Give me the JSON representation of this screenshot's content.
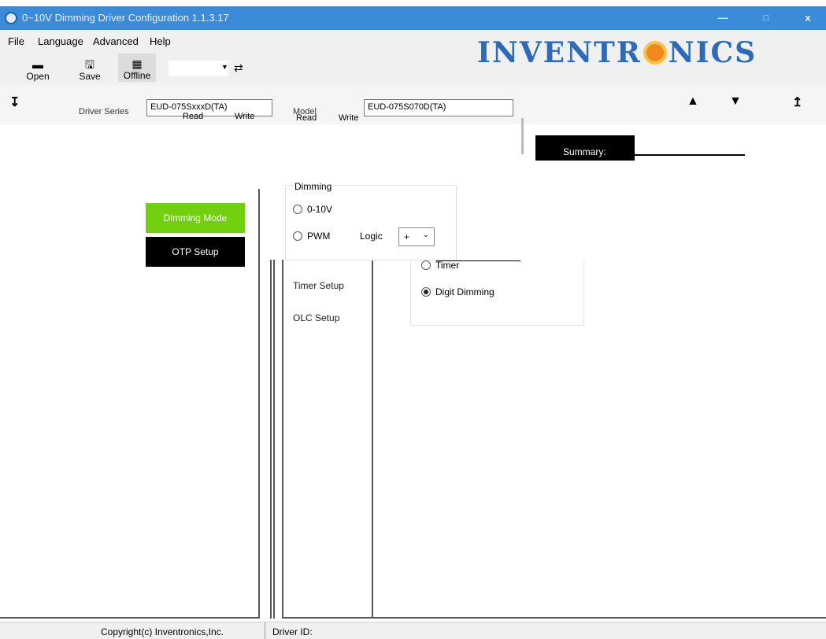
{
  "window": {
    "title": "0~10V Dimming Driver Configuration 1.1.3.17",
    "minimize_glyph": "—",
    "maximize_glyph": "□",
    "close_glyph": "x"
  },
  "menu": {
    "items": [
      {
        "label": "File"
      },
      {
        "label": "Language"
      },
      {
        "label": "Advanced"
      },
      {
        "label": "Help"
      }
    ]
  },
  "toolbar": {
    "open_label": "Open",
    "save_label": "Save",
    "offline_label": "Offline",
    "port_value": "",
    "icons": [
      "folder-icon",
      "floppy-disk-icon",
      "driver-icon",
      "usb-icon"
    ]
  },
  "logo": {
    "text_left": "INVENTR",
    "text_right": "NICS",
    "brand_color": "#2d6ab8"
  },
  "series": {
    "driver_series_label": "Driver Series",
    "driver_series_value": "EUD-075SxxxD(TA)",
    "model_label": "Model",
    "model_value": "EUD-075S070D(TA)",
    "read_label": "Read",
    "write_label": "Write"
  },
  "summary": {
    "tab_label": "Summary:"
  },
  "sidebar": {
    "dimming_mode_label": "Dimming Mode",
    "otp_setup_label": "OTP Setup",
    "active_color": "#72d00e"
  },
  "subnav": {
    "timer_setup_label": "Timer Setup",
    "olc_setup_label": "OLC Setup"
  },
  "dimming": {
    "group_title": "Dimming",
    "options": [
      {
        "label": "0-10V",
        "selected": false
      },
      {
        "label": "PWM",
        "selected": false
      },
      {
        "label": "Timer",
        "selected": false
      },
      {
        "label": "Digit Dimming",
        "selected": true
      }
    ],
    "logic_label": "Logic",
    "logic_value": "+",
    "logic_options": [
      "+",
      "-"
    ]
  },
  "status": {
    "copyright": "Copyright(c) Inventronics,Inc.",
    "driver_id_label": "Driver ID:"
  }
}
